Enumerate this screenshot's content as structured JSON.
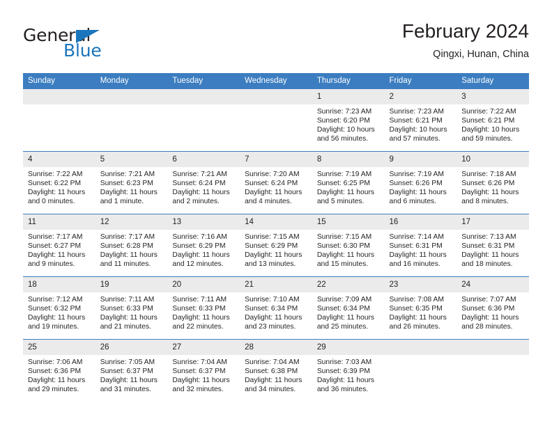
{
  "brand": {
    "name_part1": "General",
    "name_part2": "Blue"
  },
  "header": {
    "title": "February 2024",
    "location": "Qingxi, Hunan, China"
  },
  "weekday_headers": [
    "Sunday",
    "Monday",
    "Tuesday",
    "Wednesday",
    "Thursday",
    "Friday",
    "Saturday"
  ],
  "colors": {
    "header_blue": "#3b7dc0",
    "brand_blue": "#1b75bc",
    "daynum_gray": "#ebebeb",
    "text": "#231f20"
  },
  "weeks": [
    [
      {
        "day": "",
        "lines": []
      },
      {
        "day": "",
        "lines": []
      },
      {
        "day": "",
        "lines": []
      },
      {
        "day": "",
        "lines": []
      },
      {
        "day": "1",
        "lines": [
          "Sunrise: 7:23 AM",
          "Sunset: 6:20 PM",
          "Daylight: 10 hours",
          "and 56 minutes."
        ]
      },
      {
        "day": "2",
        "lines": [
          "Sunrise: 7:23 AM",
          "Sunset: 6:21 PM",
          "Daylight: 10 hours",
          "and 57 minutes."
        ]
      },
      {
        "day": "3",
        "lines": [
          "Sunrise: 7:22 AM",
          "Sunset: 6:21 PM",
          "Daylight: 10 hours",
          "and 59 minutes."
        ]
      }
    ],
    [
      {
        "day": "4",
        "lines": [
          "Sunrise: 7:22 AM",
          "Sunset: 6:22 PM",
          "Daylight: 11 hours",
          "and 0 minutes."
        ]
      },
      {
        "day": "5",
        "lines": [
          "Sunrise: 7:21 AM",
          "Sunset: 6:23 PM",
          "Daylight: 11 hours",
          "and 1 minute."
        ]
      },
      {
        "day": "6",
        "lines": [
          "Sunrise: 7:21 AM",
          "Sunset: 6:24 PM",
          "Daylight: 11 hours",
          "and 2 minutes."
        ]
      },
      {
        "day": "7",
        "lines": [
          "Sunrise: 7:20 AM",
          "Sunset: 6:24 PM",
          "Daylight: 11 hours",
          "and 4 minutes."
        ]
      },
      {
        "day": "8",
        "lines": [
          "Sunrise: 7:19 AM",
          "Sunset: 6:25 PM",
          "Daylight: 11 hours",
          "and 5 minutes."
        ]
      },
      {
        "day": "9",
        "lines": [
          "Sunrise: 7:19 AM",
          "Sunset: 6:26 PM",
          "Daylight: 11 hours",
          "and 6 minutes."
        ]
      },
      {
        "day": "10",
        "lines": [
          "Sunrise: 7:18 AM",
          "Sunset: 6:26 PM",
          "Daylight: 11 hours",
          "and 8 minutes."
        ]
      }
    ],
    [
      {
        "day": "11",
        "lines": [
          "Sunrise: 7:17 AM",
          "Sunset: 6:27 PM",
          "Daylight: 11 hours",
          "and 9 minutes."
        ]
      },
      {
        "day": "12",
        "lines": [
          "Sunrise: 7:17 AM",
          "Sunset: 6:28 PM",
          "Daylight: 11 hours",
          "and 11 minutes."
        ]
      },
      {
        "day": "13",
        "lines": [
          "Sunrise: 7:16 AM",
          "Sunset: 6:29 PM",
          "Daylight: 11 hours",
          "and 12 minutes."
        ]
      },
      {
        "day": "14",
        "lines": [
          "Sunrise: 7:15 AM",
          "Sunset: 6:29 PM",
          "Daylight: 11 hours",
          "and 13 minutes."
        ]
      },
      {
        "day": "15",
        "lines": [
          "Sunrise: 7:15 AM",
          "Sunset: 6:30 PM",
          "Daylight: 11 hours",
          "and 15 minutes."
        ]
      },
      {
        "day": "16",
        "lines": [
          "Sunrise: 7:14 AM",
          "Sunset: 6:31 PM",
          "Daylight: 11 hours",
          "and 16 minutes."
        ]
      },
      {
        "day": "17",
        "lines": [
          "Sunrise: 7:13 AM",
          "Sunset: 6:31 PM",
          "Daylight: 11 hours",
          "and 18 minutes."
        ]
      }
    ],
    [
      {
        "day": "18",
        "lines": [
          "Sunrise: 7:12 AM",
          "Sunset: 6:32 PM",
          "Daylight: 11 hours",
          "and 19 minutes."
        ]
      },
      {
        "day": "19",
        "lines": [
          "Sunrise: 7:11 AM",
          "Sunset: 6:33 PM",
          "Daylight: 11 hours",
          "and 21 minutes."
        ]
      },
      {
        "day": "20",
        "lines": [
          "Sunrise: 7:11 AM",
          "Sunset: 6:33 PM",
          "Daylight: 11 hours",
          "and 22 minutes."
        ]
      },
      {
        "day": "21",
        "lines": [
          "Sunrise: 7:10 AM",
          "Sunset: 6:34 PM",
          "Daylight: 11 hours",
          "and 23 minutes."
        ]
      },
      {
        "day": "22",
        "lines": [
          "Sunrise: 7:09 AM",
          "Sunset: 6:34 PM",
          "Daylight: 11 hours",
          "and 25 minutes."
        ]
      },
      {
        "day": "23",
        "lines": [
          "Sunrise: 7:08 AM",
          "Sunset: 6:35 PM",
          "Daylight: 11 hours",
          "and 26 minutes."
        ]
      },
      {
        "day": "24",
        "lines": [
          "Sunrise: 7:07 AM",
          "Sunset: 6:36 PM",
          "Daylight: 11 hours",
          "and 28 minutes."
        ]
      }
    ],
    [
      {
        "day": "25",
        "lines": [
          "Sunrise: 7:06 AM",
          "Sunset: 6:36 PM",
          "Daylight: 11 hours",
          "and 29 minutes."
        ]
      },
      {
        "day": "26",
        "lines": [
          "Sunrise: 7:05 AM",
          "Sunset: 6:37 PM",
          "Daylight: 11 hours",
          "and 31 minutes."
        ]
      },
      {
        "day": "27",
        "lines": [
          "Sunrise: 7:04 AM",
          "Sunset: 6:37 PM",
          "Daylight: 11 hours",
          "and 32 minutes."
        ]
      },
      {
        "day": "28",
        "lines": [
          "Sunrise: 7:04 AM",
          "Sunset: 6:38 PM",
          "Daylight: 11 hours",
          "and 34 minutes."
        ]
      },
      {
        "day": "29",
        "lines": [
          "Sunrise: 7:03 AM",
          "Sunset: 6:39 PM",
          "Daylight: 11 hours",
          "and 36 minutes."
        ]
      },
      {
        "day": "",
        "lines": []
      },
      {
        "day": "",
        "lines": []
      }
    ]
  ]
}
